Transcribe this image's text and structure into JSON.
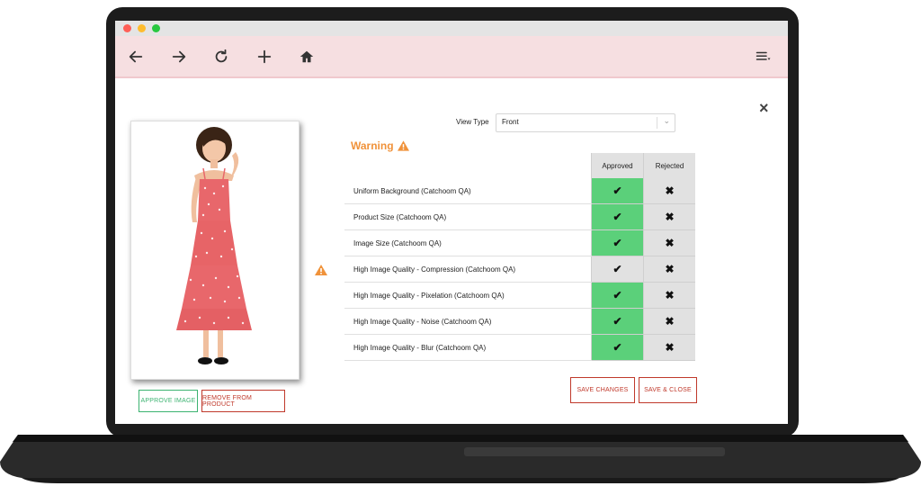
{
  "toolbar": {
    "icons": [
      "back-arrow-icon",
      "forward-arrow-icon",
      "reload-icon",
      "new-tab-icon",
      "home-icon",
      "menu-icon"
    ]
  },
  "modal": {
    "view_type_label": "View Type",
    "view_type_value": "Front",
    "warning_title": "Warning",
    "headers": {
      "approved": "Approved",
      "rejected": "Rejected"
    },
    "rows": [
      {
        "label": "Uniform Background (Catchoom QA)",
        "approved": "✔",
        "rejected": "✖",
        "approved_active": true
      },
      {
        "label": "Product Size (Catchoom QA)",
        "approved": "✔",
        "rejected": "✖",
        "approved_active": true
      },
      {
        "label": "Image Size (Catchoom QA)",
        "approved": "✔",
        "rejected": "✖",
        "approved_active": true
      },
      {
        "label": "High Image Quality - Compression (Catchoom QA)",
        "approved": "✔",
        "rejected": "✖",
        "approved_active": false
      },
      {
        "label": "High Image Quality - Pixelation (Catchoom QA)",
        "approved": "✔",
        "rejected": "✖",
        "approved_active": true
      },
      {
        "label": "High Image Quality - Noise (Catchoom QA)",
        "approved": "✔",
        "rejected": "✖",
        "approved_active": true
      },
      {
        "label": "High Image Quality - Blur (Catchoom QA)",
        "approved": "✔",
        "rejected": "✖",
        "approved_active": true
      }
    ],
    "buttons": {
      "approve_image": "APPROVE IMAGE",
      "remove_from_product": "REMOVE FROM PRODUCT",
      "save_changes": "SAVE CHANGES",
      "save_close": "SAVE & CLOSE"
    },
    "close": "×"
  },
  "colors": {
    "toolbar_bg": "#f6dfe1",
    "approved_green": "#5bd07a",
    "warning_orange": "#f0923a",
    "red_button": "#c0392b",
    "green_button": "#3cb371",
    "dress": "#e8676b"
  }
}
